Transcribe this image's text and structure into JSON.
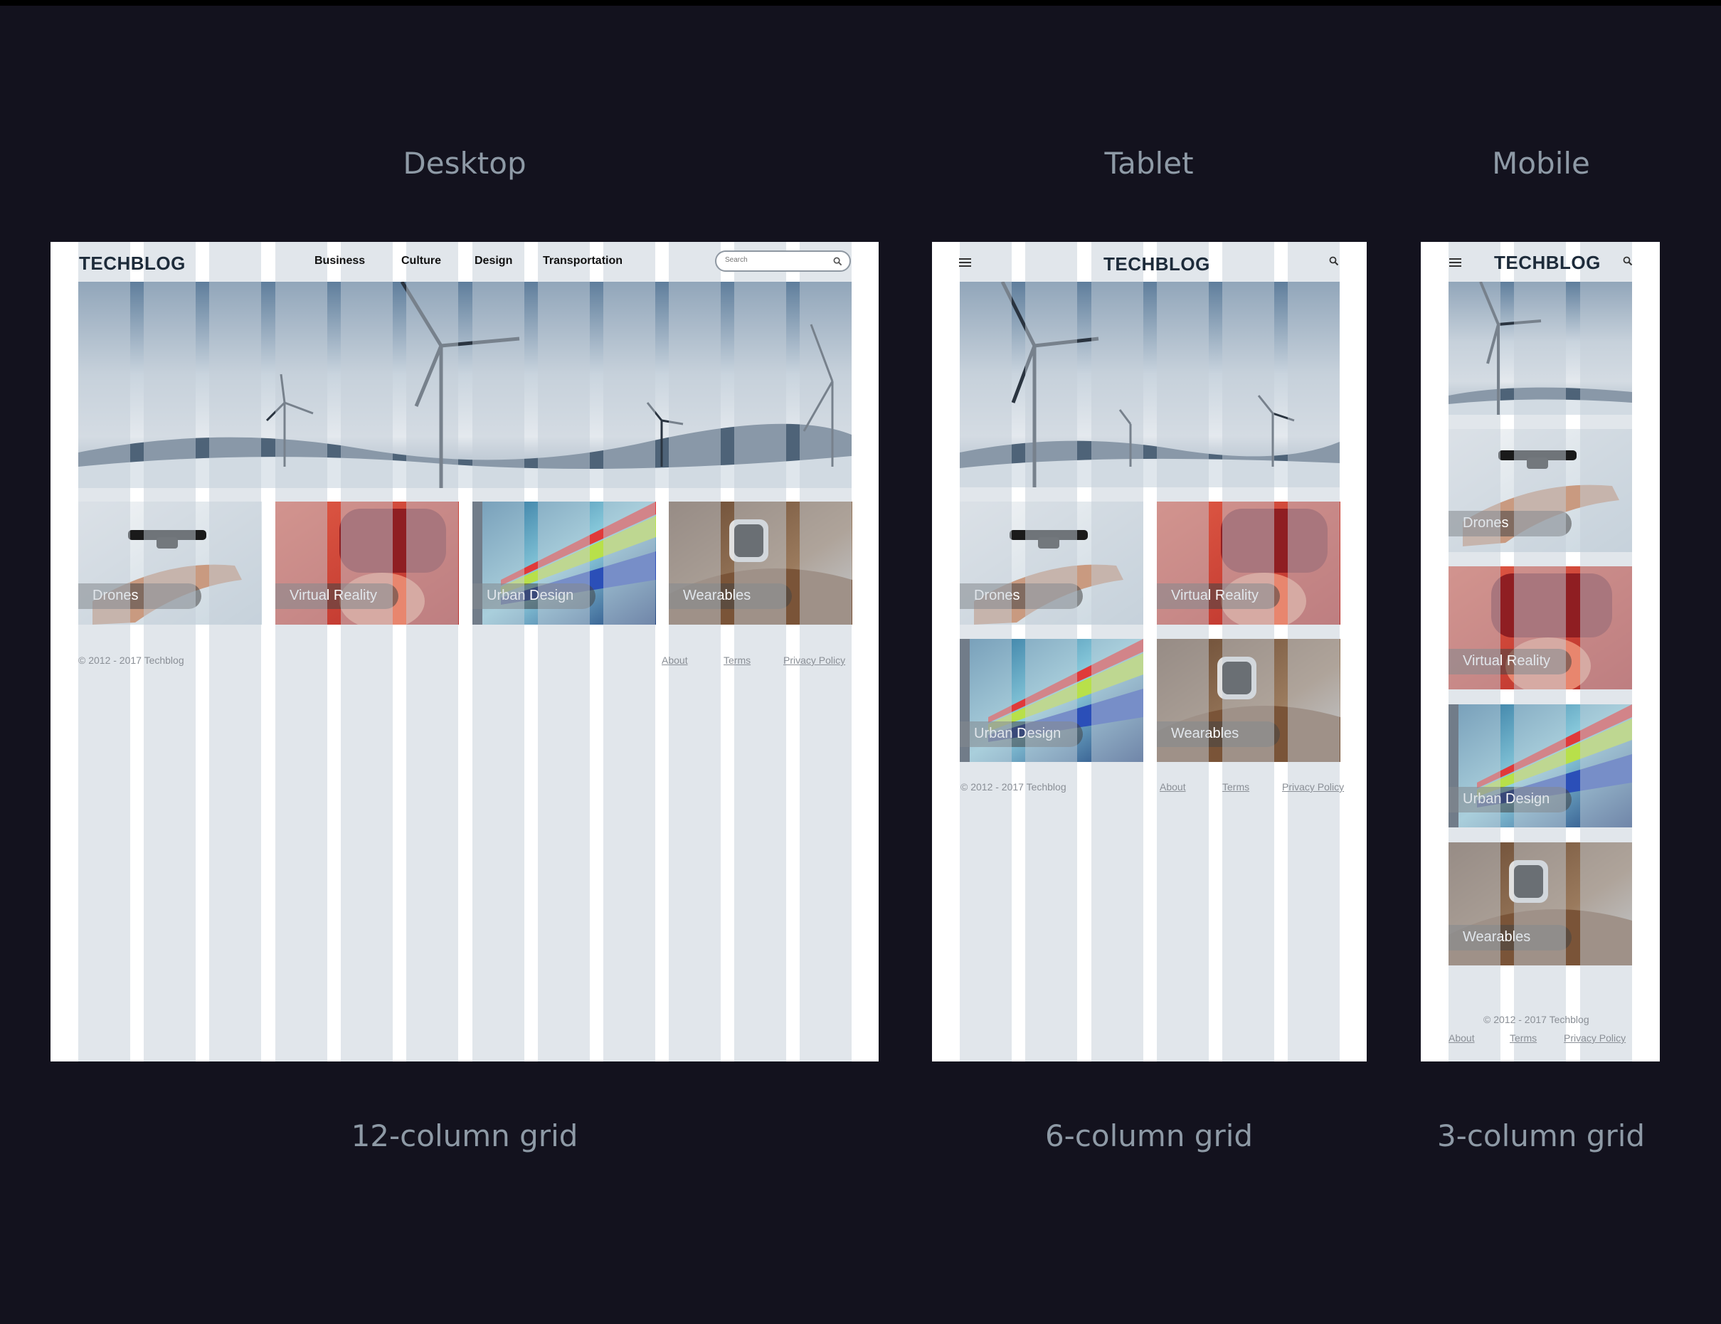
{
  "labels": {
    "desktop": "Desktop",
    "tablet": "Tablet",
    "mobile": "Mobile",
    "desktop_grid": "12-column grid",
    "tablet_grid": "6-column grid",
    "mobile_grid": "3-column grid"
  },
  "site": {
    "brand": "TECHBLOG",
    "nav": [
      "Business",
      "Culture",
      "Design",
      "Transportation"
    ],
    "search_placeholder": "Search",
    "categories": [
      "Drones",
      "Virtual Reality",
      "Urban Design",
      "Wearables"
    ],
    "copyright": "© 2012 - 2017 Techblog",
    "footer_links": [
      "About",
      "Terms",
      "Privacy Policy"
    ]
  },
  "icons": {
    "menu": "hamburger-menu-icon",
    "search": "magnifier-search-icon"
  },
  "colors": {
    "background": "#13121e",
    "frame": "#ffffff",
    "grid_column": "#c3ced8",
    "brand_text": "#1d2b3a",
    "label_text": "#8e9aa6"
  }
}
